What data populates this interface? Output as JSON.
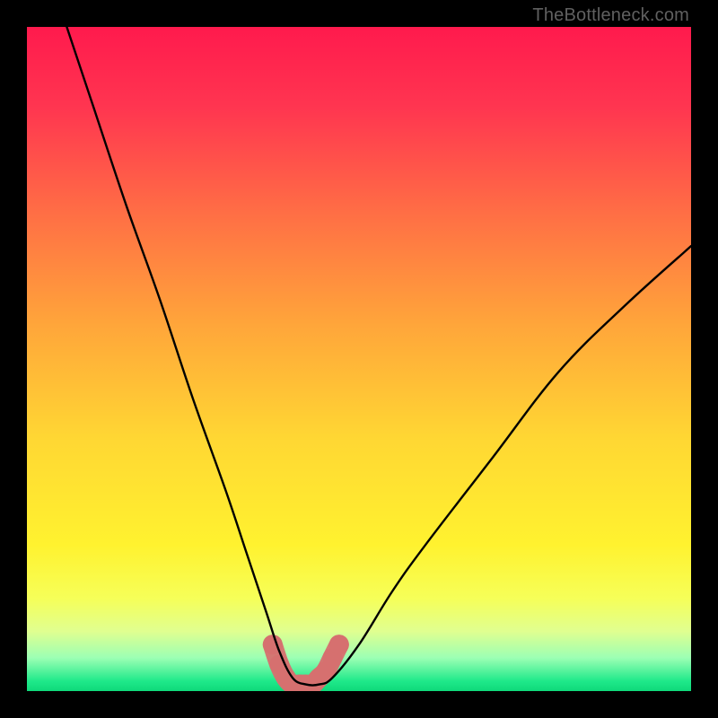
{
  "watermark": "TheBottleneck.com",
  "chart_data": {
    "type": "line",
    "title": "",
    "xlabel": "",
    "ylabel": "",
    "xlim": [
      0,
      100
    ],
    "ylim": [
      0,
      100
    ],
    "grid": false,
    "legend": false,
    "series": [
      {
        "name": "bottleneck-curve",
        "x": [
          6,
          10,
          15,
          20,
          25,
          30,
          33,
          36,
          38,
          40,
          42,
          44,
          46,
          50,
          55,
          60,
          70,
          80,
          90,
          100
        ],
        "y": [
          100,
          88,
          73,
          59,
          44,
          30,
          21,
          12,
          6,
          2,
          1,
          1,
          2,
          7,
          15,
          22,
          35,
          48,
          58,
          67
        ]
      }
    ],
    "annotations": [
      {
        "name": "valley-marker",
        "points_x": [
          37,
          38,
          39,
          40,
          41,
          42,
          43,
          44,
          45,
          46,
          47
        ],
        "points_y": [
          7,
          4,
          2,
          1,
          1,
          1,
          1,
          2,
          3,
          5,
          7
        ],
        "style": "thick-faded-red"
      }
    ],
    "background": {
      "type": "vertical-gradient",
      "stops": [
        {
          "pos": 0.0,
          "color": "#ff1a4d"
        },
        {
          "pos": 0.12,
          "color": "#ff3550"
        },
        {
          "pos": 0.28,
          "color": "#ff6e45"
        },
        {
          "pos": 0.45,
          "color": "#ffa63a"
        },
        {
          "pos": 0.62,
          "color": "#ffd733"
        },
        {
          "pos": 0.78,
          "color": "#fff22f"
        },
        {
          "pos": 0.86,
          "color": "#f6ff58"
        },
        {
          "pos": 0.91,
          "color": "#e0ff90"
        },
        {
          "pos": 0.95,
          "color": "#9cffb4"
        },
        {
          "pos": 0.985,
          "color": "#1fe98a"
        },
        {
          "pos": 1.0,
          "color": "#0fd97a"
        }
      ]
    }
  }
}
